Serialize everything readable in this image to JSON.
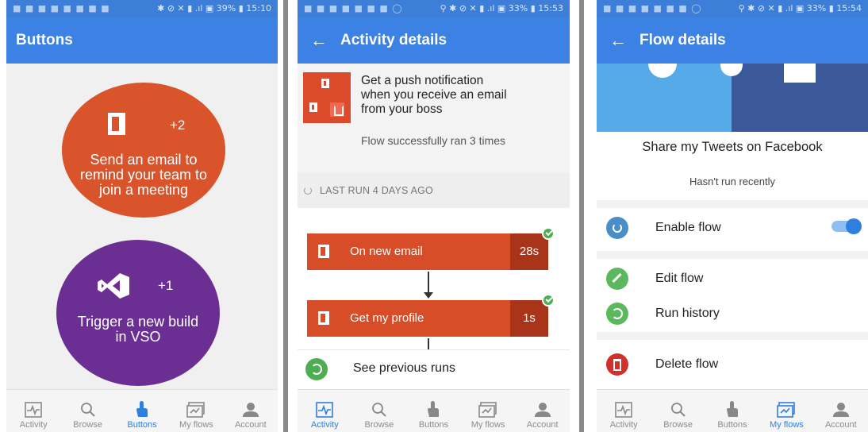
{
  "screens": [
    {
      "status": {
        "left": "■ ■ ■ ■ ■ ■ ■ ■",
        "right": "✱ ⊘ ✕ ▮ .ıl ▣ 39% ▮ 15:10"
      },
      "title": "Buttons",
      "buttons": [
        {
          "count": "+2",
          "label": "Send an email to remind your team to join a meeting",
          "color": "#d9532b",
          "icon": "office-icon"
        },
        {
          "count": "+1",
          "label": "Trigger a new build in VSO",
          "color": "#6b2f94",
          "icon": "visual-studio-icon"
        }
      ],
      "active_tab": "Buttons"
    },
    {
      "status": {
        "left": "■ ■ ■ ■ ■ ■ ■ ◯",
        "right": "⚲ ✱ ⊘ ✕ ▮ .ıl ▣ 33% ▮ 15:53"
      },
      "title": "Activity details",
      "summary": {
        "title": "Get a push notification when you receive an email from your boss",
        "status": "Flow successfully ran 3 times"
      },
      "last_run": "LAST RUN 4 DAYS AGO",
      "steps": [
        {
          "name": "On new email",
          "duration": "28s",
          "status": "succeeded"
        },
        {
          "name": "Get my profile",
          "duration": "1s",
          "status": "succeeded"
        }
      ],
      "see_previous": "See previous runs",
      "active_tab": "Activity"
    },
    {
      "status": {
        "left": "■ ■ ■ ■ ■ ■ ■ ◯",
        "right": "⚲ ✱ ⊘ ✕ ▮ .ıl ▣ 33% ▮ 15:54"
      },
      "title": "Flow details",
      "flow_name": "Share my Tweets on Facebook",
      "run_status": "Hasn't run recently",
      "actions": {
        "enable": "Enable flow",
        "enable_on": true,
        "edit": "Edit flow",
        "history": "Run history",
        "delete": "Delete flow"
      },
      "active_tab": "My flows"
    }
  ],
  "nav": {
    "activity": "Activity",
    "browse": "Browse",
    "buttons": "Buttons",
    "myflows": "My flows",
    "account": "Account"
  },
  "colors": {
    "accent": "#3b82e4",
    "office_orange": "#d74d28",
    "vso_purple": "#6b2f94",
    "success": "#4cae50",
    "danger": "#d0312d"
  }
}
